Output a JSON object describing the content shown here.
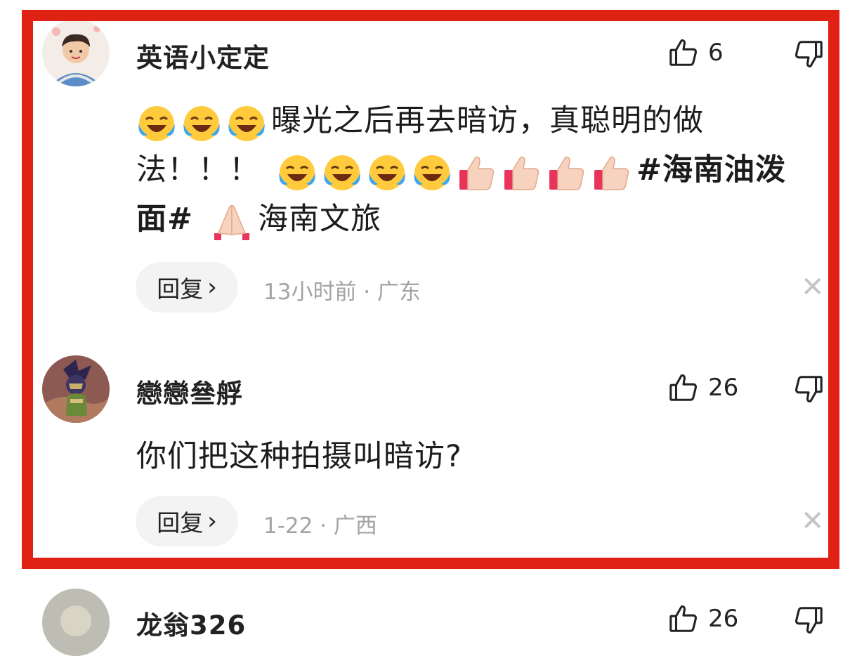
{
  "comments": [
    {
      "username": "英语小定定",
      "like_count": "6",
      "text_line1": "曝光之后再去暗访，真聪明的做",
      "text_line2a": "法！！！",
      "hashtag_a": "#海南油泼",
      "hashtag_b": "面#",
      "text_line3b": "海南文旅",
      "reply_label": "回复",
      "reply_chevron": "›",
      "meta": "13小时前 · 广东",
      "icons": [
        "thumbs-up-outline",
        "thumbs-down-outline",
        "laugh-cry-emoji",
        "thumbs-up-emoji",
        "pray-emoji",
        "close-x"
      ]
    },
    {
      "username": "戀戀叄艀",
      "like_count": "26",
      "text": "你们把这种拍摄叫暗访?",
      "reply_label": "回复",
      "reply_chevron": "›",
      "meta": "1-22 · 广西"
    },
    {
      "username": "龙翁326",
      "like_count": "26"
    }
  ],
  "colors": {
    "highlight_border": "#e02215",
    "meta_text": "#a3a3a3",
    "reply_bg": "#f3f3f3"
  }
}
